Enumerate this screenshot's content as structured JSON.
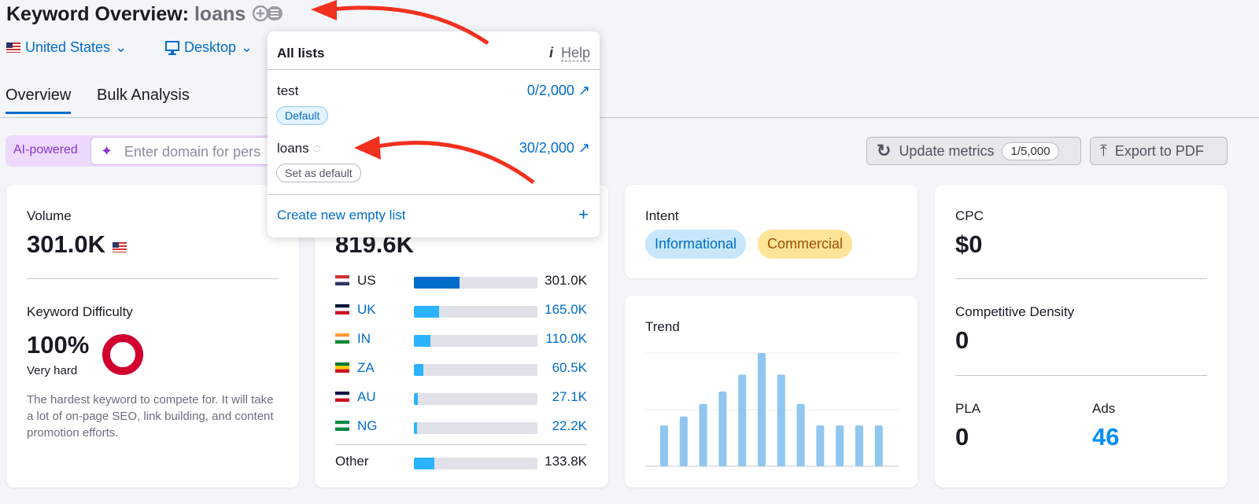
{
  "header": {
    "title": "Keyword Overview:",
    "keyword": "loans",
    "add_to_list_icon": "add-to-list-icon"
  },
  "selectors": {
    "country": "United States",
    "device": "Desktop"
  },
  "tabs": [
    {
      "label": "Overview",
      "active": true
    },
    {
      "label": "Bulk Analysis",
      "active": false
    }
  ],
  "ai": {
    "badge": "AI-powered",
    "placeholder": "Enter domain for pers"
  },
  "toolbar": {
    "update_label": "Update metrics",
    "update_count": "1/5,000",
    "export_label": "Export to PDF"
  },
  "popup": {
    "title": "All lists",
    "help": "Help",
    "lists": [
      {
        "name": "test",
        "count": "0/2,000",
        "badge": "Default"
      },
      {
        "name": "loans",
        "count": "30/2,000",
        "badge": "Set as default"
      }
    ],
    "create": "Create new empty list"
  },
  "volume": {
    "label": "Volume",
    "value": "301.0K"
  },
  "difficulty": {
    "label": "Keyword Difficulty",
    "value": "100%",
    "level": "Very hard",
    "percent": 100,
    "description": "The hardest keyword to compete for. It will take a lot of on-page SEO, link building, and content promotion efforts."
  },
  "global": {
    "value": "819.6K",
    "countries": [
      {
        "code": "US",
        "value": "301.0K",
        "num": 301.0
      },
      {
        "code": "UK",
        "value": "165.0K",
        "num": 165.0
      },
      {
        "code": "IN",
        "value": "110.0K",
        "num": 110.0
      },
      {
        "code": "ZA",
        "value": "60.5K",
        "num": 60.5
      },
      {
        "code": "AU",
        "value": "27.1K",
        "num": 27.1
      },
      {
        "code": "NG",
        "value": "22.2K",
        "num": 22.2
      }
    ],
    "other": {
      "label": "Other",
      "value": "133.8K",
      "num": 133.8
    }
  },
  "intent": {
    "label": "Intent",
    "tags": [
      "Informational",
      "Commercial"
    ]
  },
  "trend": {
    "label": "Trend",
    "relative_values": [
      0.36,
      0.44,
      0.55,
      0.66,
      0.81,
      1.0,
      0.81,
      0.55,
      0.36,
      0.36,
      0.36,
      0.36
    ]
  },
  "cpc": {
    "label": "CPC",
    "value": "$0"
  },
  "density": {
    "label": "Competitive Density",
    "value": "0"
  },
  "pla": {
    "label": "PLA",
    "value": "0"
  },
  "ads": {
    "label": "Ads",
    "value": "46"
  },
  "colors": {
    "accent": "#006dca",
    "annotation_arrow": "#f2301e",
    "difficulty_ring": "#d1002f",
    "trend_bar": "#90c6f0"
  }
}
